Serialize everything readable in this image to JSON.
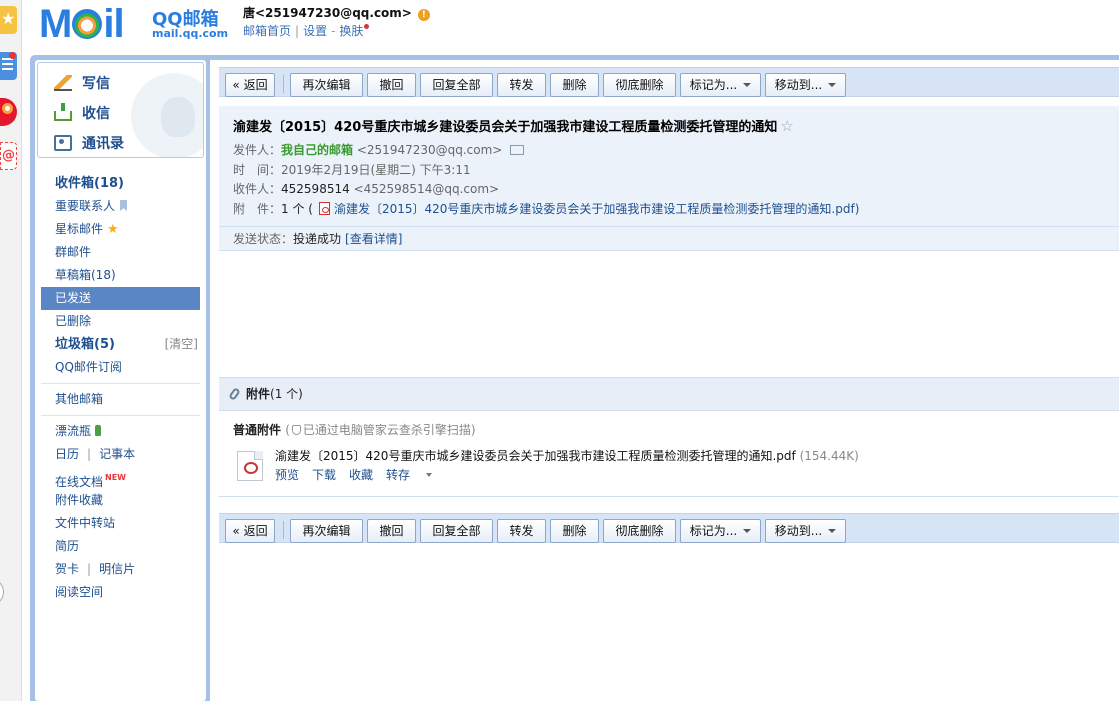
{
  "dock": {
    "icons": [
      "star-icon",
      "list-icon",
      "weibo-icon",
      "at-icon"
    ]
  },
  "header": {
    "logo_word": "MOil",
    "logo_brand": "QQ邮箱",
    "logo_domain": "mail.qq.com",
    "user": "唐<251947230@qq.com>",
    "nav_home": "邮箱首页",
    "nav_settings": "设置",
    "nav_skin": "换肤",
    "nav_sep": "|",
    "nav_dash": "-"
  },
  "sidebar": {
    "write": "写信",
    "receive": "收信",
    "contacts": "通讯录",
    "folders": {
      "inbox": "收件箱(18)",
      "vip": "重要联系人",
      "starred": "星标邮件",
      "group": "群邮件",
      "drafts": "草稿箱(18)",
      "sent": "已发送",
      "deleted": "已删除",
      "spam": "垃圾箱(5)",
      "spam_clear": "[清空]",
      "subscription": "QQ邮件订阅",
      "other": "其他邮箱",
      "bottle": "漂流瓶",
      "calendar": "日历",
      "notes": "记事本",
      "docs": "在线文档",
      "docs_badge": "NEW",
      "att_fav": "附件收藏",
      "transfer": "文件中转站",
      "resume": "简历",
      "card": "贺卡",
      "postcard": "明信片",
      "reading": "阅读空间",
      "pipe": "|"
    }
  },
  "toolbar": {
    "back": "« 返回",
    "reedit": "再次编辑",
    "recall": "撤回",
    "reply_all": "回复全部",
    "forward": "转发",
    "delete": "删除",
    "delete_perm": "彻底删除",
    "mark_as": "标记为...",
    "move_to": "移动到..."
  },
  "mail": {
    "subject": "渝建发〔2015〕420号重庆市城乡建设委员会关于加强我市建设工程质量检测委托管理的通知",
    "subject_star": "☆",
    "from_label": "发件人：",
    "from_name": "我自己的邮箱",
    "from_addr": "<251947230@qq.com>",
    "time_label": "时　间：",
    "time_value": "2019年2月19日(星期二) 下午3:11",
    "to_label": "收件人：",
    "to_name": "452598514",
    "to_addr": "<452598514@qq.com>",
    "att_label": "附　件：",
    "att_count": "1 个 (",
    "att_file": "渝建发〔2015〕420号重庆市城乡建设委员会关于加强我市建设工程质量检测委托管理的通知.pdf)",
    "status_label": "发送状态：",
    "status_value": "投递成功",
    "status_link": "[查看详情]"
  },
  "attachments": {
    "header_bold": "附件",
    "header_count": "(1 个)",
    "section_title": "普通附件",
    "scan_open": "(",
    "scan_text": "已通过电脑管家云查杀引擎扫描)",
    "file_name": "渝建发〔2015〕420号重庆市城乡建设委员会关于加强我市建设工程质量检测委托管理的通知.pdf",
    "file_size": "(154.44K)",
    "preview": "预览",
    "download": "下载",
    "collect": "收藏",
    "save_to": "转存"
  }
}
